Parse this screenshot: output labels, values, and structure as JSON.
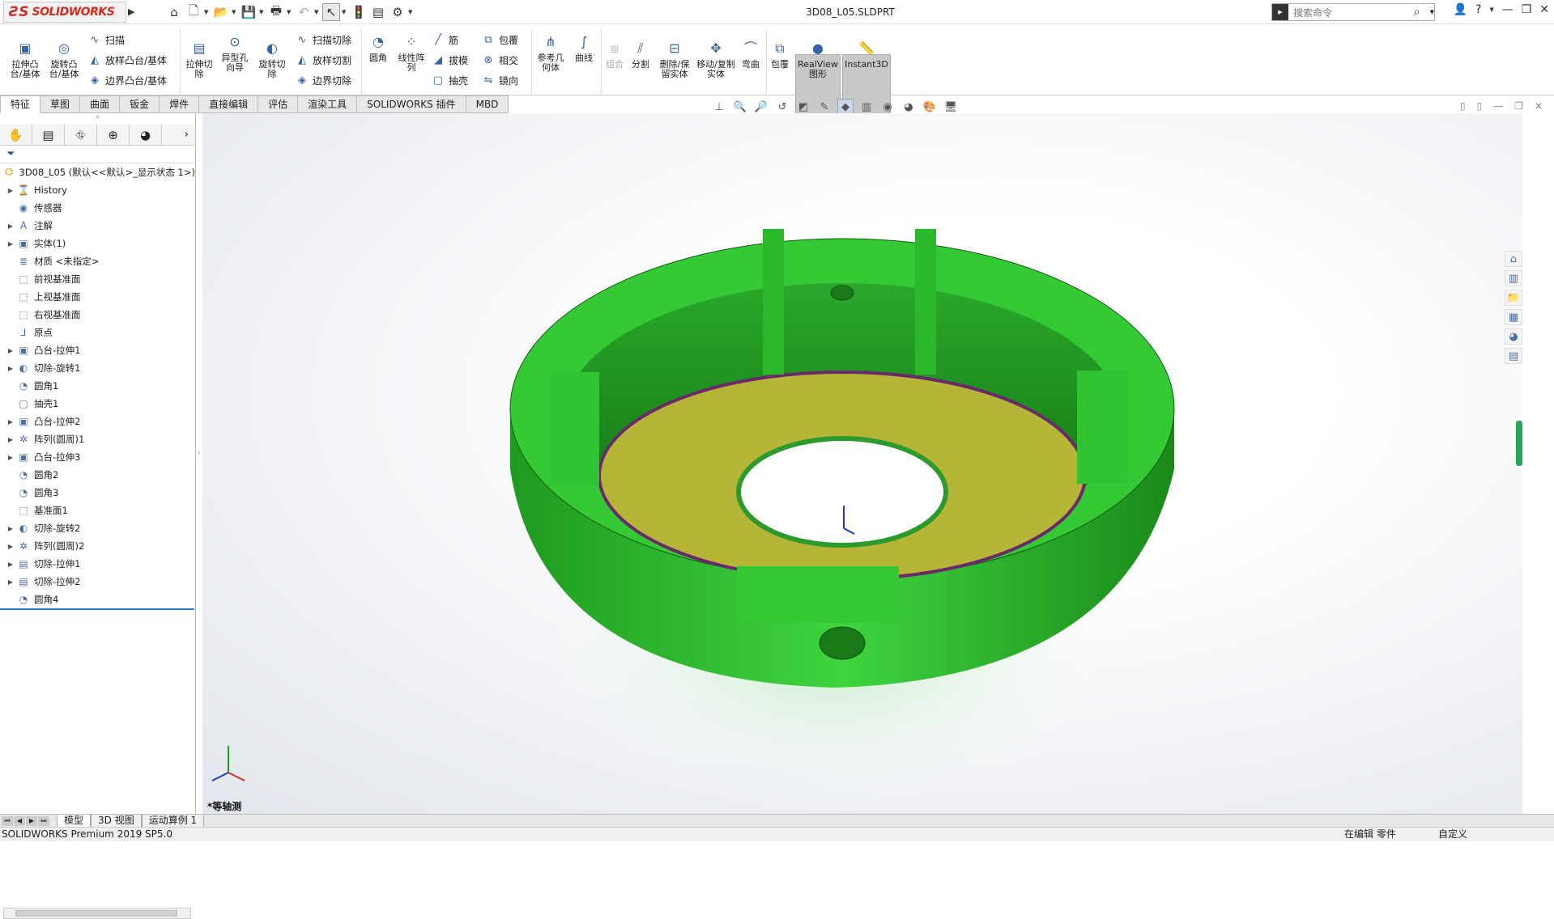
{
  "app": {
    "brand": "SOLIDWORKS",
    "document_title": "3D08_L05.SLDPRT",
    "search_placeholder": "搜索命令"
  },
  "ribbon": {
    "features": [
      "拉伸凸台/基体",
      "旋转凸台/基体",
      "扫描",
      "放样凸台/基体",
      "边界凸台/基体",
      "拉伸切除",
      "异型孔向导",
      "旋转切除",
      "扫描切除",
      "放样切割",
      "边界切除",
      "圆角",
      "线性阵列",
      "筋",
      "拔模",
      "抽壳",
      "包覆",
      "相交",
      "镜向",
      "参考几何体",
      "曲线",
      "组合",
      "分割",
      "删除/保留实体",
      "移动/复制实体",
      "弯曲",
      "包覆",
      "RealView图形",
      "Instant3D"
    ]
  },
  "tabs": [
    "特征",
    "草图",
    "曲面",
    "钣金",
    "焊件",
    "直接编辑",
    "评估",
    "渲染工具",
    "SOLIDWORKS 插件",
    "MBD"
  ],
  "active_tab": "特征",
  "tree": {
    "root": "3D08_L05  (默认<<默认>_显示状态 1>)",
    "items": [
      {
        "label": "History",
        "expand": true,
        "icon": "history-icon"
      },
      {
        "label": "传感器",
        "expand": false,
        "icon": "sensor-icon"
      },
      {
        "label": "注解",
        "expand": true,
        "icon": "annotation-icon"
      },
      {
        "label": "实体(1)",
        "expand": true,
        "icon": "solid-bodies-icon"
      },
      {
        "label": "材质 <未指定>",
        "expand": false,
        "icon": "material-icon"
      },
      {
        "label": "前视基准面",
        "expand": false,
        "icon": "plane-icon"
      },
      {
        "label": "上视基准面",
        "expand": false,
        "icon": "plane-icon"
      },
      {
        "label": "右视基准面",
        "expand": false,
        "icon": "plane-icon"
      },
      {
        "label": "原点",
        "expand": false,
        "icon": "origin-icon"
      },
      {
        "label": "凸台-拉伸1",
        "expand": true,
        "icon": "boss-extrude-icon"
      },
      {
        "label": "切除-旋转1",
        "expand": true,
        "icon": "cut-revolve-icon"
      },
      {
        "label": "圆角1",
        "expand": false,
        "icon": "fillet-icon"
      },
      {
        "label": "抽壳1",
        "expand": false,
        "icon": "shell-icon"
      },
      {
        "label": "凸台-拉伸2",
        "expand": true,
        "icon": "boss-extrude-icon"
      },
      {
        "label": "阵列(圆周)1",
        "expand": true,
        "icon": "circular-pattern-icon"
      },
      {
        "label": "凸台-拉伸3",
        "expand": true,
        "icon": "boss-extrude-icon"
      },
      {
        "label": "圆角2",
        "expand": false,
        "icon": "fillet-icon"
      },
      {
        "label": "圆角3",
        "expand": false,
        "icon": "fillet-icon"
      },
      {
        "label": "基准面1",
        "expand": false,
        "icon": "plane-icon"
      },
      {
        "label": "切除-旋转2",
        "expand": true,
        "icon": "cut-revolve-icon"
      },
      {
        "label": "阵列(圆周)2",
        "expand": true,
        "icon": "circular-pattern-icon"
      },
      {
        "label": "切除-拉伸1",
        "expand": true,
        "icon": "cut-extrude-icon"
      },
      {
        "label": "切除-拉伸2",
        "expand": true,
        "icon": "cut-extrude-icon"
      },
      {
        "label": "圆角4",
        "expand": false,
        "icon": "fillet-icon"
      }
    ]
  },
  "viewport": {
    "view_label": "*等轴测",
    "colors": {
      "body": "#2fbf2f",
      "floor": "#b5b538",
      "inner": "#6a2a6a"
    }
  },
  "bottom_tabs": [
    "模型",
    "3D 视图",
    "运动算例 1"
  ],
  "status": {
    "version": "SOLIDWORKS Premium 2019 SP5.0",
    "editing": "在编辑 零件",
    "custom": "自定义"
  }
}
